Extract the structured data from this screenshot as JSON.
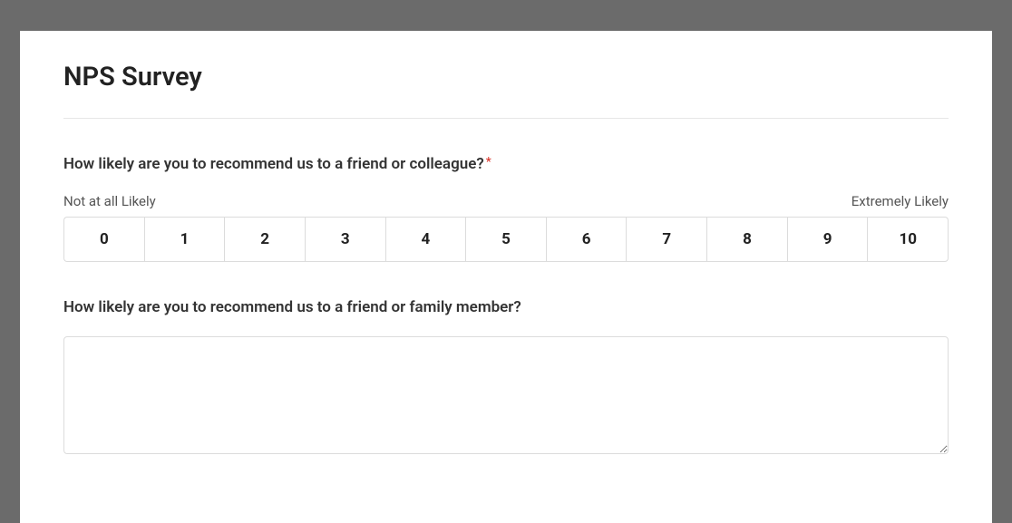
{
  "survey": {
    "title": "NPS Survey",
    "q1": {
      "label": "How likely are you to recommend us to a friend or colleague?",
      "required_mark": "*",
      "low_anchor": "Not at all Likely",
      "high_anchor": "Extremely Likely",
      "options": [
        "0",
        "1",
        "2",
        "3",
        "4",
        "5",
        "6",
        "7",
        "8",
        "9",
        "10"
      ]
    },
    "q2": {
      "label": "How likely are you to recommend us to a friend or family member?",
      "value": "",
      "placeholder": ""
    }
  }
}
